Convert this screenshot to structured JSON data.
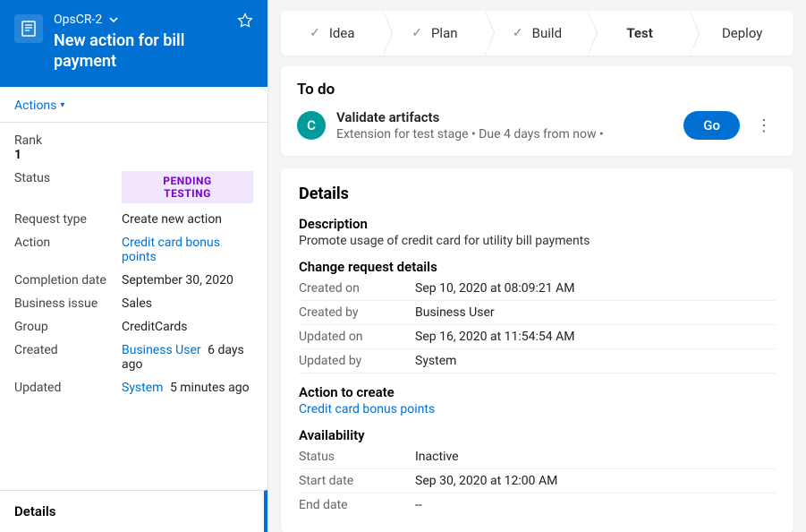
{
  "header": {
    "id": "OpsCR-2",
    "title": "New action for bill payment"
  },
  "actions_label": "Actions",
  "meta": {
    "rank_label": "Rank",
    "rank_value": "1",
    "status_label": "Status",
    "status_value": "PENDING TESTING",
    "request_type_label": "Request type",
    "request_type_value": "Create new action",
    "action_label": "Action",
    "action_value": "Credit card bonus points",
    "completion_label": "Completion date",
    "completion_value": "September 30, 2020",
    "bi_label": "Business issue",
    "bi_value": "Sales",
    "group_label": "Group",
    "group_value": "CreditCards",
    "created_label": "Created",
    "created_user": "Business User",
    "created_time": "6 days ago",
    "updated_label": "Updated",
    "updated_user": "System",
    "updated_time": "5 minutes ago"
  },
  "left_tab": "Details",
  "stages": {
    "s1": "Idea",
    "s2": "Plan",
    "s3": "Build",
    "s4": "Test",
    "s5": "Deploy"
  },
  "todo": {
    "heading": "To do",
    "avatar": "C",
    "task": "Validate artifacts",
    "sub": "Extension for test stage  •  Due 4 days from now  •",
    "go": "Go"
  },
  "details": {
    "heading": "Details",
    "desc_label": "Description",
    "desc_value": "Promote usage of credit card for utility bill payments",
    "crd_label": "Change request details",
    "created_on_l": "Created on",
    "created_on_v": "Sep 10, 2020 at 08:09:21 AM",
    "created_by_l": "Created by",
    "created_by_v": "Business User",
    "updated_on_l": "Updated on",
    "updated_on_v": "Sep 16, 2020 at 11:54:54 AM",
    "updated_by_l": "Updated by",
    "updated_by_v": "System",
    "atc_label": "Action to create",
    "atc_link": "Credit card bonus points",
    "avail_label": "Availability",
    "avail_status_l": "Status",
    "avail_status_v": "Inactive",
    "avail_start_l": "Start date",
    "avail_start_v": "Sep 30, 2020 at 12:00 AM",
    "avail_end_l": "End date",
    "avail_end_v": "--"
  }
}
